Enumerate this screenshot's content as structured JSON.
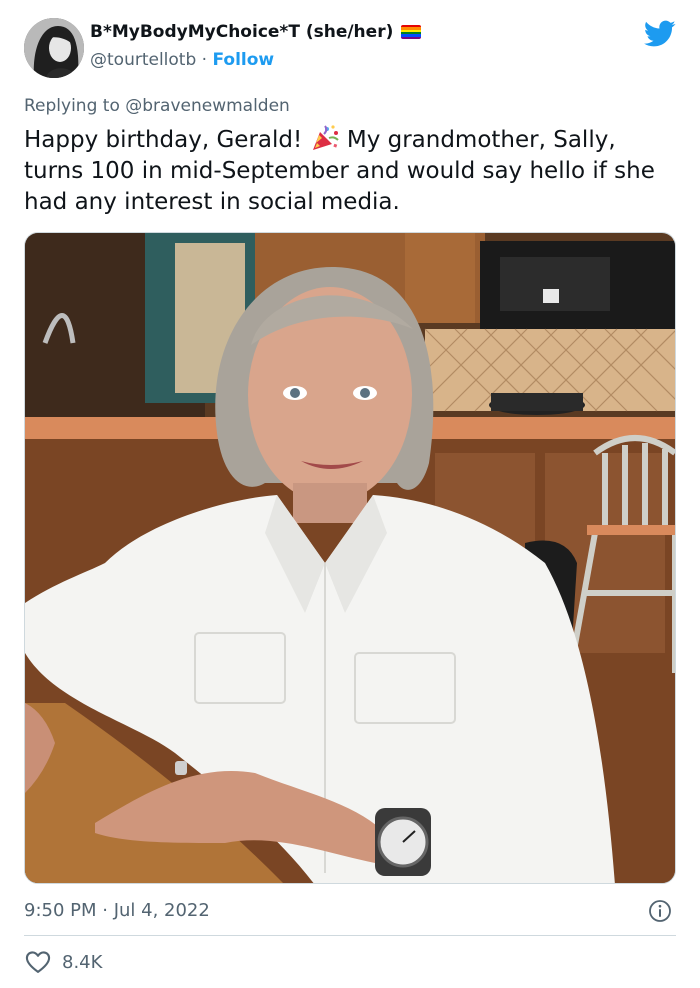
{
  "author": {
    "display_name": "B*MyBodyMyChoice*T (she/her)",
    "handle": "@tourtellotb",
    "separator": "·",
    "follow_label": "Follow",
    "avatar_icon": "profile-photo",
    "flag_icon": "rainbow-flag-icon"
  },
  "reply": {
    "prefix": "Replying to",
    "mention": "@bravenewmalden"
  },
  "tweet": {
    "text_before_emoji": "Happy birthday, Gerald!",
    "emoji_icon": "party-popper-icon",
    "text_after_emoji": "My grandmother, Sally, turns 100 in mid-September and would say hello if she had any interest in social media.",
    "timestamp": "9:50 PM · Jul 4, 2022"
  },
  "engagement": {
    "likes": "8.4K",
    "like_icon": "heart-icon"
  },
  "colors": {
    "accent": "#1d9bf0",
    "text_primary": "#0f1419",
    "text_secondary": "#536471",
    "divider": "#cfd9de"
  }
}
